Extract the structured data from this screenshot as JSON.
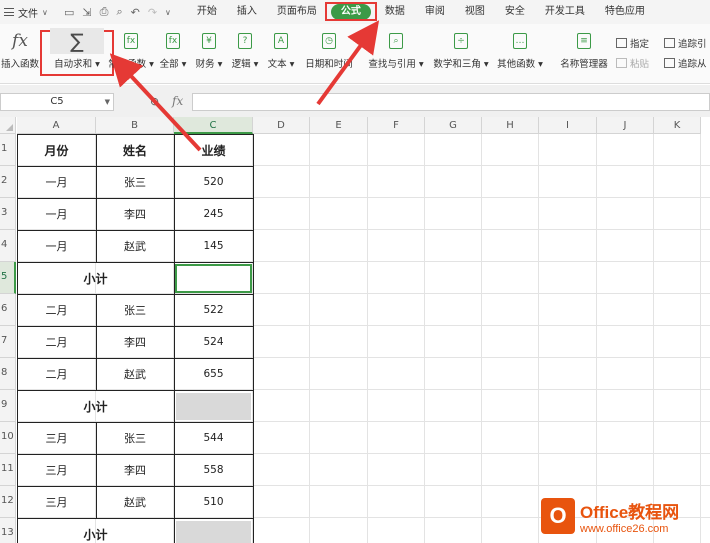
{
  "menubar": {
    "file_label": "文件",
    "tabs": [
      "开始",
      "插入",
      "页面布局",
      "公式",
      "数据",
      "审阅",
      "视图",
      "安全",
      "开发工具",
      "特色应用"
    ],
    "active_tab": "公式"
  },
  "ribbon": {
    "insert_function": "插入函数",
    "autosum": "自动求和",
    "common_functions": "常用函数",
    "all": "全部",
    "financial": "财务",
    "logical": "逻辑",
    "text": "文本",
    "datetime": "日期和时间",
    "lookup": "查找与引用",
    "math": "数学和三角",
    "other": "其他函数",
    "name_manager": "名称管理器",
    "specify": "指定",
    "paste": "粘贴",
    "trace_precedents": "追踪引",
    "trace_dependents": "追踪从"
  },
  "formula_bar": {
    "name_box": "C5",
    "fx_label": "fx",
    "content": ""
  },
  "columns": [
    "A",
    "B",
    "C",
    "D",
    "E",
    "F",
    "G",
    "H",
    "I",
    "J",
    "K"
  ],
  "selected_column": "C",
  "rows": [
    "1",
    "2",
    "3",
    "4",
    "5",
    "6",
    "7",
    "8",
    "9",
    "10",
    "11",
    "12",
    "13"
  ],
  "selected_row": "5",
  "table": {
    "headers": [
      "月份",
      "姓名",
      "业绩"
    ],
    "data": [
      {
        "row": 2,
        "month": "一月",
        "name": "张三",
        "value": "520"
      },
      {
        "row": 3,
        "month": "一月",
        "name": "李四",
        "value": "245"
      },
      {
        "row": 4,
        "month": "一月",
        "name": "赵武",
        "value": "145"
      },
      {
        "row": 6,
        "month": "二月",
        "name": "张三",
        "value": "522"
      },
      {
        "row": 7,
        "month": "二月",
        "name": "李四",
        "value": "524"
      },
      {
        "row": 8,
        "month": "二月",
        "name": "赵武",
        "value": "655"
      },
      {
        "row": 10,
        "month": "三月",
        "name": "张三",
        "value": "544"
      },
      {
        "row": 11,
        "month": "三月",
        "name": "李四",
        "value": "558"
      },
      {
        "row": 12,
        "month": "三月",
        "name": "赵武",
        "value": "510"
      }
    ],
    "subtotal_label": "小计"
  },
  "watermark": {
    "brand": "Office教程网",
    "url": "www.office26.com",
    "logo_letter": "O"
  },
  "colors": {
    "accent_green": "#3c9a47",
    "annotation_red": "#e53935",
    "watermark_orange": "#e8540e"
  }
}
